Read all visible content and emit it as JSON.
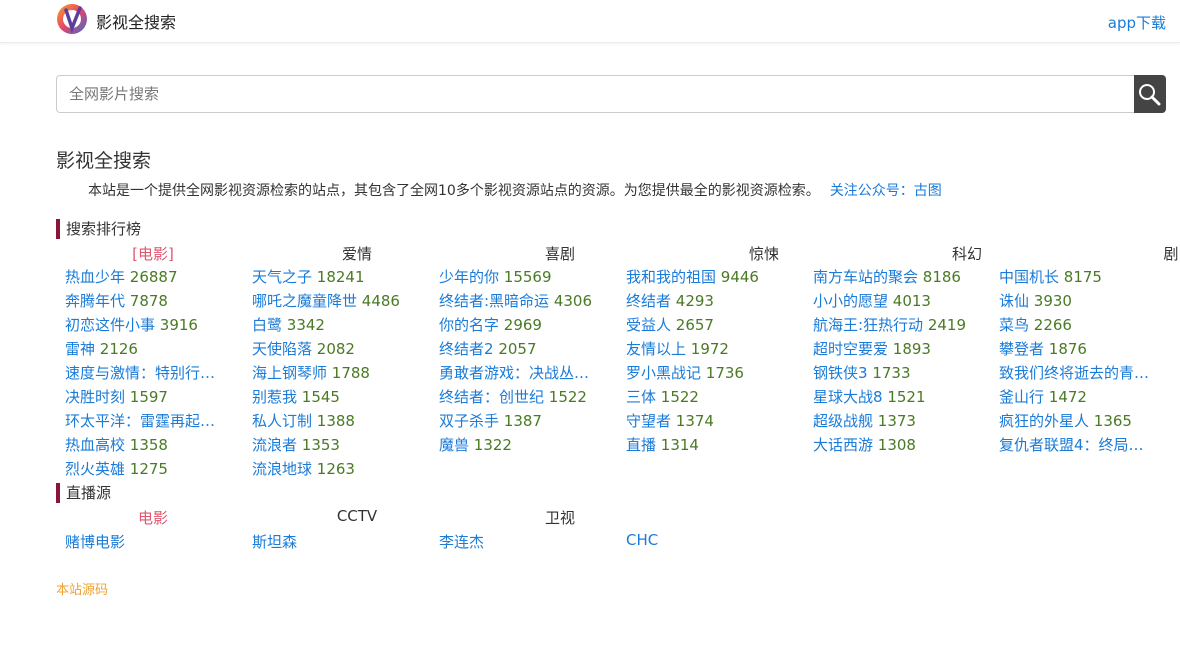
{
  "header": {
    "site_name": "影视全搜索",
    "app_download": "app下载"
  },
  "search": {
    "placeholder": "全网影片搜索",
    "value": ""
  },
  "intro": {
    "title": "影视全搜索",
    "text": "本站是一个提供全网影视资源检索的站点，其包含了全网10多个影视资源站点的资源。为您提供最全的影视资源检索。",
    "link": "关注公众号：古图"
  },
  "ranking": {
    "title": "搜索排行榜",
    "categories": [
      "[电影]",
      "爱情",
      "喜剧",
      "惊悚",
      "科幻",
      "剧"
    ],
    "columns": [
      [
        {
          "name": "热血少年",
          "count": "26887"
        },
        {
          "name": "奔腾年代",
          "count": "7878"
        },
        {
          "name": "初恋这件小事",
          "count": "3916"
        },
        {
          "name": "雷神",
          "count": "2126"
        },
        {
          "name": "速度与激情：特别行…",
          "count": ""
        },
        {
          "name": "决胜时刻",
          "count": "1597"
        },
        {
          "name": "环太平洋：雷霆再起…",
          "count": ""
        },
        {
          "name": "热血高校",
          "count": "1358"
        },
        {
          "name": "烈火英雄",
          "count": "1275"
        }
      ],
      [
        {
          "name": "天气之子",
          "count": "18241"
        },
        {
          "name": "哪吒之魔童降世",
          "count": "4486"
        },
        {
          "name": "白鹭",
          "count": "3342"
        },
        {
          "name": "天使陷落",
          "count": "2082"
        },
        {
          "name": "海上钢琴师",
          "count": "1788"
        },
        {
          "name": "别惹我",
          "count": "1545"
        },
        {
          "name": "私人订制",
          "count": "1388"
        },
        {
          "name": "流浪者",
          "count": "1353"
        },
        {
          "name": "流浪地球",
          "count": "1263"
        }
      ],
      [
        {
          "name": "少年的你",
          "count": "15569"
        },
        {
          "name": "终结者:黑暗命运",
          "count": "4306"
        },
        {
          "name": "你的名字",
          "count": "2969"
        },
        {
          "name": "终结者2",
          "count": "2057"
        },
        {
          "name": "勇敢者游戏：决战丛…",
          "count": ""
        },
        {
          "name": "终结者：创世纪",
          "count": "1522"
        },
        {
          "name": "双子杀手",
          "count": "1387"
        },
        {
          "name": "魔兽",
          "count": "1322"
        }
      ],
      [
        {
          "name": "我和我的祖国",
          "count": "9446"
        },
        {
          "name": "终结者",
          "count": "4293"
        },
        {
          "name": "受益人",
          "count": "2657"
        },
        {
          "name": "友情以上",
          "count": "1972"
        },
        {
          "name": "罗小黑战记",
          "count": "1736"
        },
        {
          "name": "三体",
          "count": "1522"
        },
        {
          "name": "守望者",
          "count": "1374"
        },
        {
          "name": "直播",
          "count": "1314"
        }
      ],
      [
        {
          "name": "南方车站的聚会",
          "count": "8186"
        },
        {
          "name": "小小的愿望",
          "count": "4013"
        },
        {
          "name": "航海王:狂热行动",
          "count": "2419"
        },
        {
          "name": "超时空要爱",
          "count": "1893"
        },
        {
          "name": "钢铁侠3",
          "count": "1733"
        },
        {
          "name": "星球大战8",
          "count": "1521"
        },
        {
          "name": "超级战舰",
          "count": "1373"
        },
        {
          "name": "大话西游",
          "count": "1308"
        }
      ],
      [
        {
          "name": "中国机长",
          "count": "8175"
        },
        {
          "name": "诛仙",
          "count": "3930"
        },
        {
          "name": "菜鸟",
          "count": "2266"
        },
        {
          "name": "攀登者",
          "count": "1876"
        },
        {
          "name": "致我们终将逝去的青…",
          "count": ""
        },
        {
          "name": "釜山行",
          "count": "1472"
        },
        {
          "name": "疯狂的外星人",
          "count": "1365"
        },
        {
          "name": "复仇者联盟4：终局…",
          "count": ""
        }
      ]
    ]
  },
  "live": {
    "title": "直播源",
    "categories": [
      "电影",
      "CCTV",
      "卫视"
    ],
    "items": [
      "赌博电影",
      "斯坦森",
      "李连杰",
      "CHC"
    ]
  },
  "footer": {
    "source_link": "本站源码"
  },
  "colors": {
    "link": "#1a7bd8",
    "count": "#4a7a25",
    "active": "#e0566f",
    "accent": "#8b1538",
    "footer": "#f0a030"
  }
}
